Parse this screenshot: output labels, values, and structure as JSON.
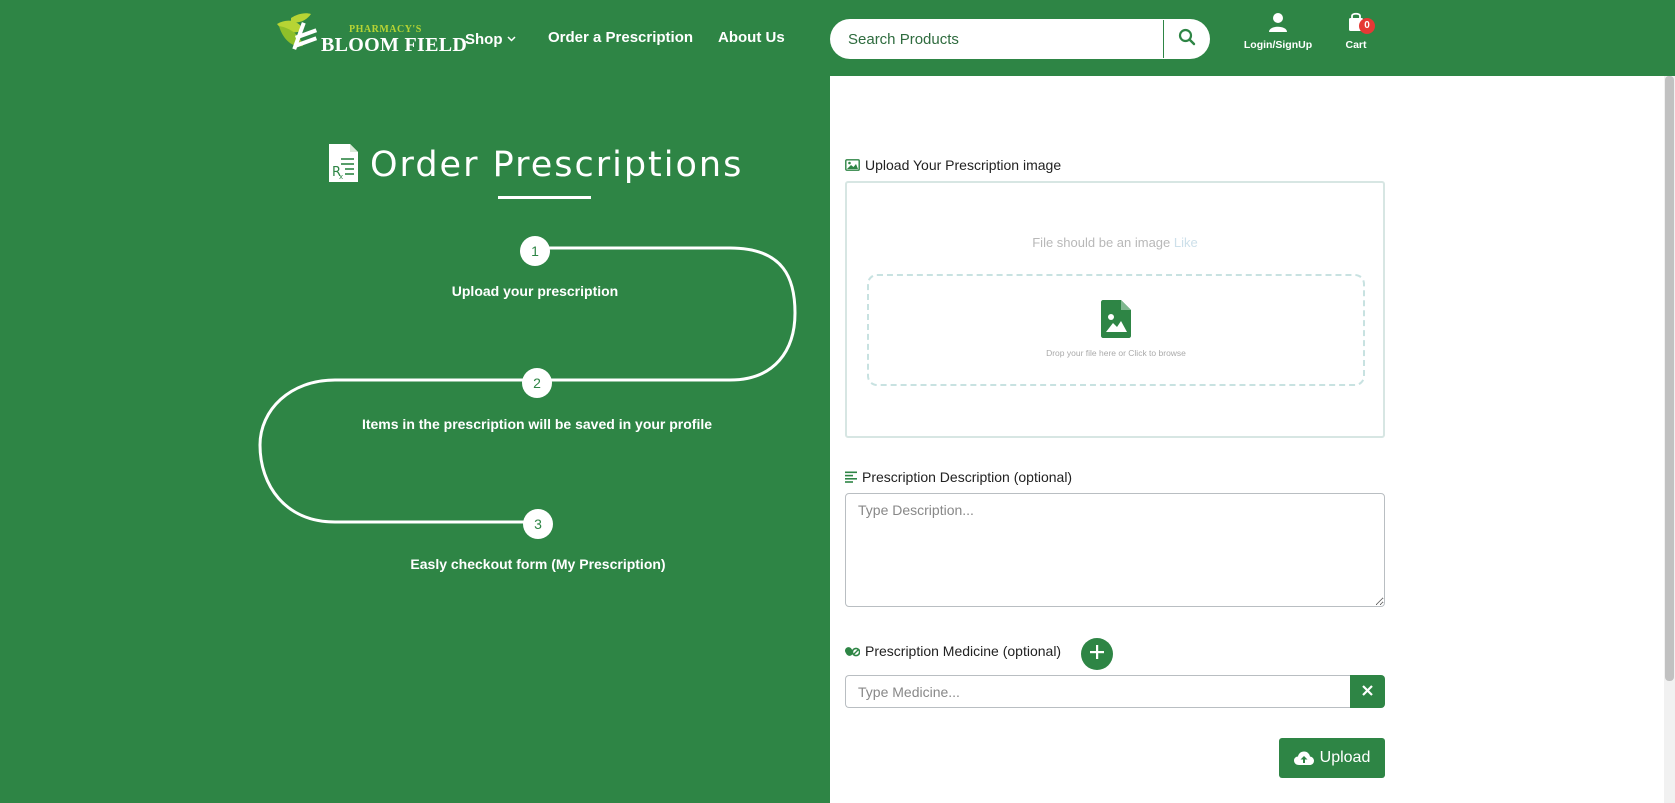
{
  "header": {
    "logo": {
      "top_text": "PHARMACY'S",
      "bottom_text": "BLOOM FIELD"
    },
    "nav": {
      "shop": "Shop",
      "order": "Order a Prescription",
      "about": "About Us"
    },
    "search": {
      "placeholder": "Search Products",
      "value": ""
    },
    "login_label": "Login/SignUp",
    "cart_label": "Cart",
    "cart_count": "0"
  },
  "left": {
    "title": "Order Prescriptions",
    "steps": [
      {
        "number": "1",
        "text": "Upload your prescription"
      },
      {
        "number": "2",
        "text": "Items in the prescription will be saved in your profile"
      },
      {
        "number": "3",
        "text": "Easly checkout form (My Prescription)"
      }
    ]
  },
  "form": {
    "upload_label": "Upload Your Prescription image",
    "upload_hint": "File should be an image",
    "upload_hint_suffix": "Like",
    "drop_text": "Drop your file here or Click to browse",
    "description_label": "Prescription Description (optional)",
    "description_placeholder": "Type Description...",
    "medicine_label": "Prescription Medicine (optional)",
    "medicine_placeholder": "Type Medicine...",
    "upload_button": "Upload"
  },
  "colors": {
    "brand_green": "#2e8545",
    "accent_lime": "#b7d434",
    "badge_red": "#e53935"
  },
  "icons": {
    "search": "search-icon",
    "user": "user-icon",
    "cart": "shopping-bag-icon",
    "title": "prescription-document-icon",
    "upload": "image-icon",
    "file": "file-image-icon",
    "description": "align-left-icon",
    "medicine": "pills-icon",
    "add": "plus-icon",
    "remove": "close-icon",
    "upload_button": "cloud-upload-icon",
    "chevron": "chevron-down-icon"
  }
}
